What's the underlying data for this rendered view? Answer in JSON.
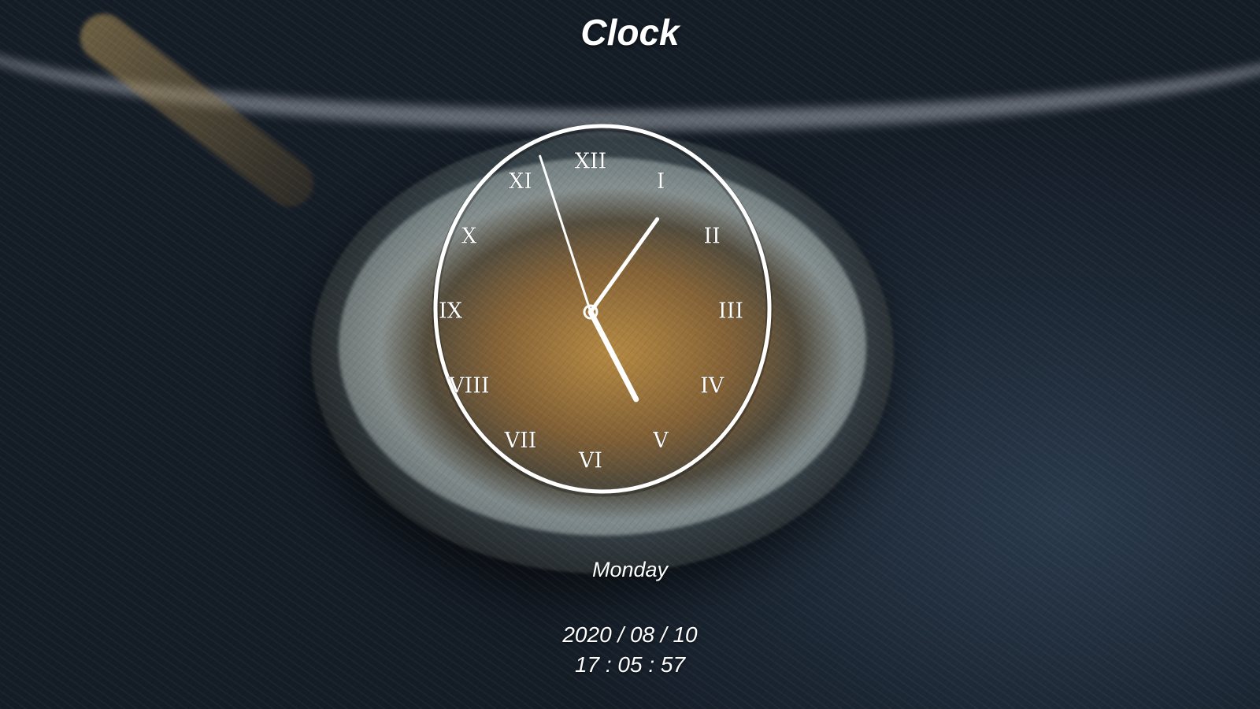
{
  "app": {
    "title": "Clock"
  },
  "clock": {
    "numerals": [
      "XII",
      "I",
      "II",
      "III",
      "IV",
      "V",
      "VI",
      "VII",
      "VIII",
      "IX",
      "X",
      "XI"
    ],
    "hands": {
      "hour": 5,
      "minute": 5,
      "second": 57
    }
  },
  "date": {
    "weekday": "Monday",
    "date_text": "2020 / 08 / 10",
    "time_text": "17 : 05 : 57"
  },
  "colors": {
    "text": "#ffffff",
    "hands": "#ffffff",
    "ring": "#ffffff"
  }
}
